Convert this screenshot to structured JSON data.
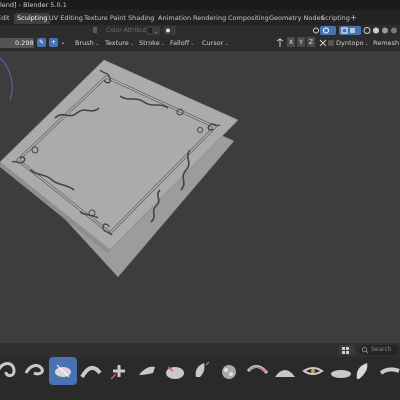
{
  "window": {
    "title": "lend] - Blender 5.0.1"
  },
  "workspace_tabs": [
    {
      "label": "Edit",
      "active": false
    },
    {
      "label": "Sculpting",
      "active": true
    },
    {
      "label": "UV Editing",
      "active": false
    },
    {
      "label": "Texture Paint",
      "active": false
    },
    {
      "label": "Shading",
      "active": false
    },
    {
      "label": "Animation",
      "active": false
    },
    {
      "label": "Rendering",
      "active": false
    },
    {
      "label": "Compositing",
      "active": false
    },
    {
      "label": "Geometry Nodes",
      "active": false
    },
    {
      "label": "Scripting",
      "active": false
    }
  ],
  "add_workspace": "+",
  "tool_header": {
    "color_attributes_label": "Color Attributes",
    "strength_value": "0.298",
    "menus": {
      "brush": "Brush",
      "texture": "Texture",
      "stroke": "Stroke",
      "falloff": "Falloff",
      "cursor": "Cursor"
    },
    "symmetry_axes": [
      "X",
      "Y",
      "Z"
    ],
    "dyntopo": "Dyntopo",
    "remesh": "Remesh"
  },
  "asset_shelf": {
    "search_placeholder": "Search",
    "brushes": [
      {
        "icon": "snake-hook-brush-icon",
        "active": false
      },
      {
        "icon": "thumb-brush-icon",
        "active": false
      },
      {
        "icon": "draw-brush-icon",
        "active": true
      },
      {
        "icon": "smooth-brush-icon",
        "active": false
      },
      {
        "icon": "pinch-brush-icon",
        "active": false
      },
      {
        "icon": "flatten-brush-icon",
        "active": false
      },
      {
        "icon": "inflate-brush-icon",
        "active": false
      },
      {
        "icon": "grab-brush-icon",
        "active": false
      },
      {
        "icon": "clay-brush-icon",
        "active": false
      },
      {
        "icon": "crease-brush-icon",
        "active": false
      },
      {
        "icon": "mask-brush-icon",
        "active": false
      },
      {
        "icon": "layer-brush-icon",
        "active": false
      },
      {
        "icon": "fill-brush-icon",
        "active": false
      },
      {
        "icon": "elastic-brush-icon",
        "active": false
      },
      {
        "icon": "nudge-brush-icon",
        "active": false
      }
    ]
  },
  "colors": {
    "viewport_bg": "#3d3d3d",
    "accent_blue": "#4772b3",
    "mesh": "#a3a3a3"
  }
}
